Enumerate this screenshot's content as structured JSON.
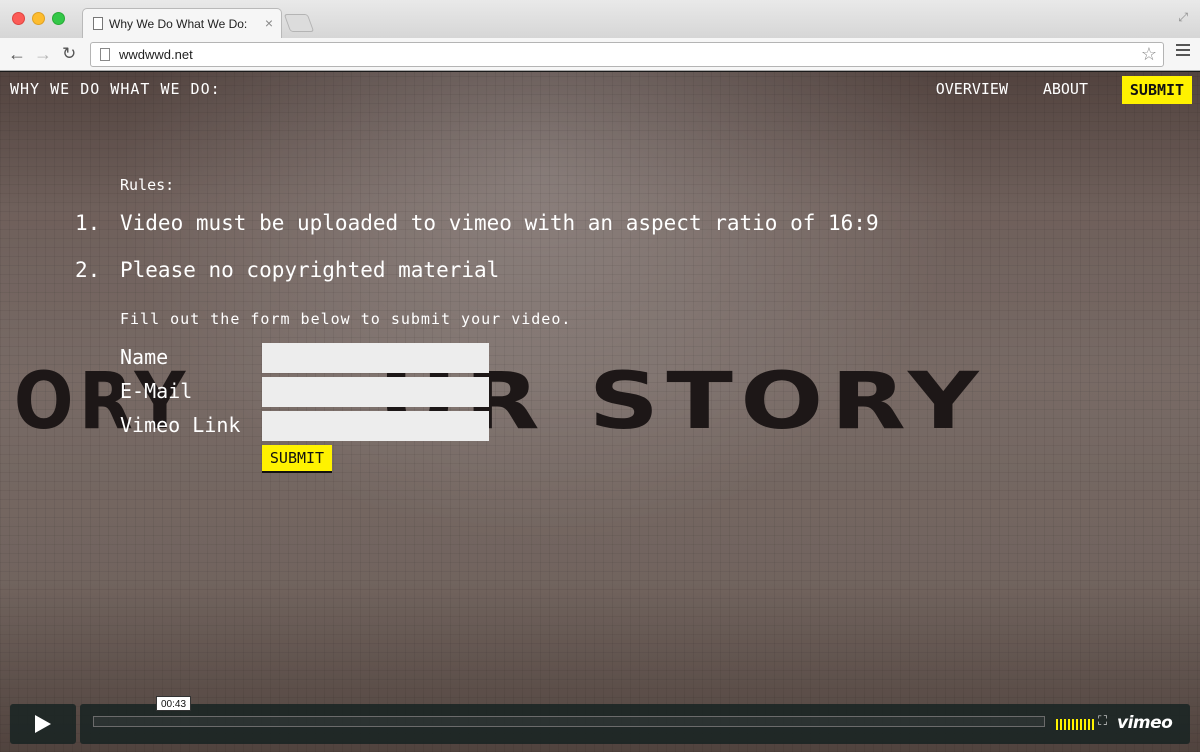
{
  "browser": {
    "tab_title": "Why We Do What We Do:",
    "tab_close": "×",
    "url": "wwdwwd.net",
    "back_glyph": "←",
    "forward_glyph": "→",
    "reload_glyph": "↻",
    "star_glyph": "☆",
    "fullscreen_glyph": "⤢"
  },
  "site": {
    "title": "WHY WE DO WHAT WE DO:",
    "nav": {
      "overview": "OVERVIEW",
      "about": "ABOUT",
      "submit": "SUBMIT"
    }
  },
  "rules": {
    "label": "Rules:",
    "items": [
      {
        "num": "1.",
        "text": "Video must be uploaded to vimeo with an aspect ratio of 16:9"
      },
      {
        "num": "2.",
        "text": "Please no copyrighted material"
      }
    ]
  },
  "form": {
    "instructions": "Fill out the form below to submit your video.",
    "name_label": "Name",
    "email_label": "E-Mail",
    "vimeo_label": "Vimeo Link",
    "name_value": "",
    "email_value": "",
    "vimeo_value": "",
    "submit_label": "SUBMIT"
  },
  "background": {
    "mural_left": "ORY",
    "mural_right": "UR STORY"
  },
  "player": {
    "time": "00:43",
    "logo": "vimeo",
    "fullscreen_glyph": "⛶",
    "progress": 0.0,
    "volume_bars": 10
  },
  "colors": {
    "accent": "#fff200",
    "player_bg": "#172322"
  }
}
